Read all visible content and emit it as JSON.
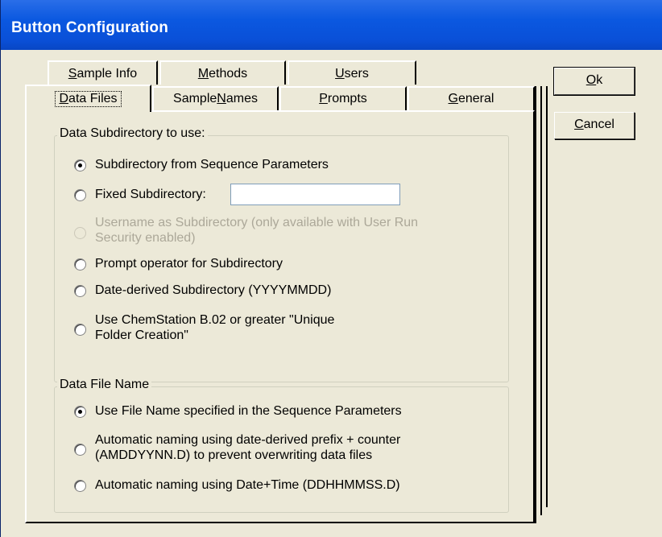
{
  "window": {
    "title": "Button Configuration"
  },
  "tabs_back": [
    {
      "label": "Sample Info",
      "accel": "S",
      "rest": "ample Info"
    },
    {
      "label": "Methods",
      "accel": "M",
      "rest": "ethods"
    },
    {
      "label": "Users",
      "accel": "U",
      "rest": "sers"
    }
  ],
  "tabs_front": [
    {
      "label": "Data Files",
      "accel": "D",
      "rest": "ata Files",
      "selected": true
    },
    {
      "label": "Sample Names",
      "pre": "Sample ",
      "accel": "N",
      "rest": "ames"
    },
    {
      "label": "Prompts",
      "accel": "P",
      "rest": "rompts"
    },
    {
      "label": "General",
      "accel": "G",
      "rest": "eneral"
    }
  ],
  "subdir_group": {
    "legend": "Data Subdirectory to use:",
    "options": [
      {
        "label": "Subdirectory from Sequence Parameters",
        "checked": true,
        "enabled": true
      },
      {
        "label": "Fixed Subdirectory:",
        "checked": false,
        "enabled": true,
        "input_value": ""
      },
      {
        "label_line1": "Username as Subdirectory (only available with User Run",
        "label_line2": "Security enabled)",
        "checked": false,
        "enabled": false
      },
      {
        "label": "Prompt operator for Subdirectory",
        "checked": false,
        "enabled": true
      },
      {
        "label": "Date-derived Subdirectory (YYYYMMDD)",
        "checked": false,
        "enabled": true
      },
      {
        "label_line1": "Use ChemStation B.02 or greater \"Unique",
        "label_line2": "Folder Creation\"",
        "checked": false,
        "enabled": true
      }
    ]
  },
  "filename_group": {
    "legend": "Data File Name",
    "options": [
      {
        "label": "Use File Name specified in the Sequence Parameters",
        "checked": true,
        "enabled": true
      },
      {
        "label_line1": "Automatic naming using date-derived prefix + counter",
        "label_line2": "(AMDDYYNN.D) to prevent overwriting data files",
        "checked": false,
        "enabled": true
      },
      {
        "label": "Automatic naming using Date+Time (DDHHMMSS.D)",
        "checked": false,
        "enabled": true
      }
    ]
  },
  "buttons": {
    "ok": {
      "label": "Ok",
      "accel": "O",
      "rest": "k"
    },
    "cancel": {
      "label": "Cancel",
      "accel": "C",
      "rest": "ancel"
    }
  }
}
